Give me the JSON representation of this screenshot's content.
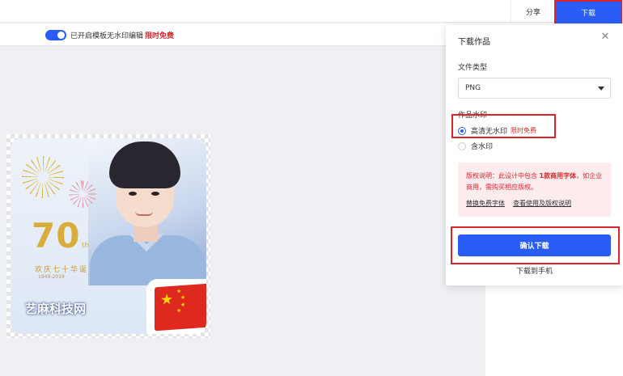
{
  "topbar": {
    "share_label": "分享",
    "download_label": "下载"
  },
  "subbar": {
    "text": "已开启模板无水印编辑",
    "free_label": "限时免费"
  },
  "poster": {
    "number": "70",
    "number_suffix": "th",
    "celebrate_text": "欢庆七十华诞",
    "years_text": "1949-2019",
    "watermark_text": "艺麻科技网"
  },
  "panel": {
    "title": "下载作品",
    "file_type_label": "文件类型",
    "file_type_value": "PNG",
    "watermark_label": "作品水印",
    "options": [
      {
        "label": "高清无水印",
        "tag": "限时免费",
        "selected": true
      },
      {
        "label": "含水印",
        "tag": "",
        "selected": false
      }
    ],
    "notice": {
      "prefix": "版权说明：此设计中包含 ",
      "bold": "1款商用字体",
      "suffix": "，如企业商用，需购买相应版权。",
      "link1": "替换免费字体",
      "link2": "查看使用及版权说明"
    },
    "confirm_label": "确认下载",
    "phone_label": "下载到手机"
  },
  "colors": {
    "accent": "#2a5cf7",
    "highlight_border": "#d8262c",
    "notice_bg": "#fdecee"
  }
}
